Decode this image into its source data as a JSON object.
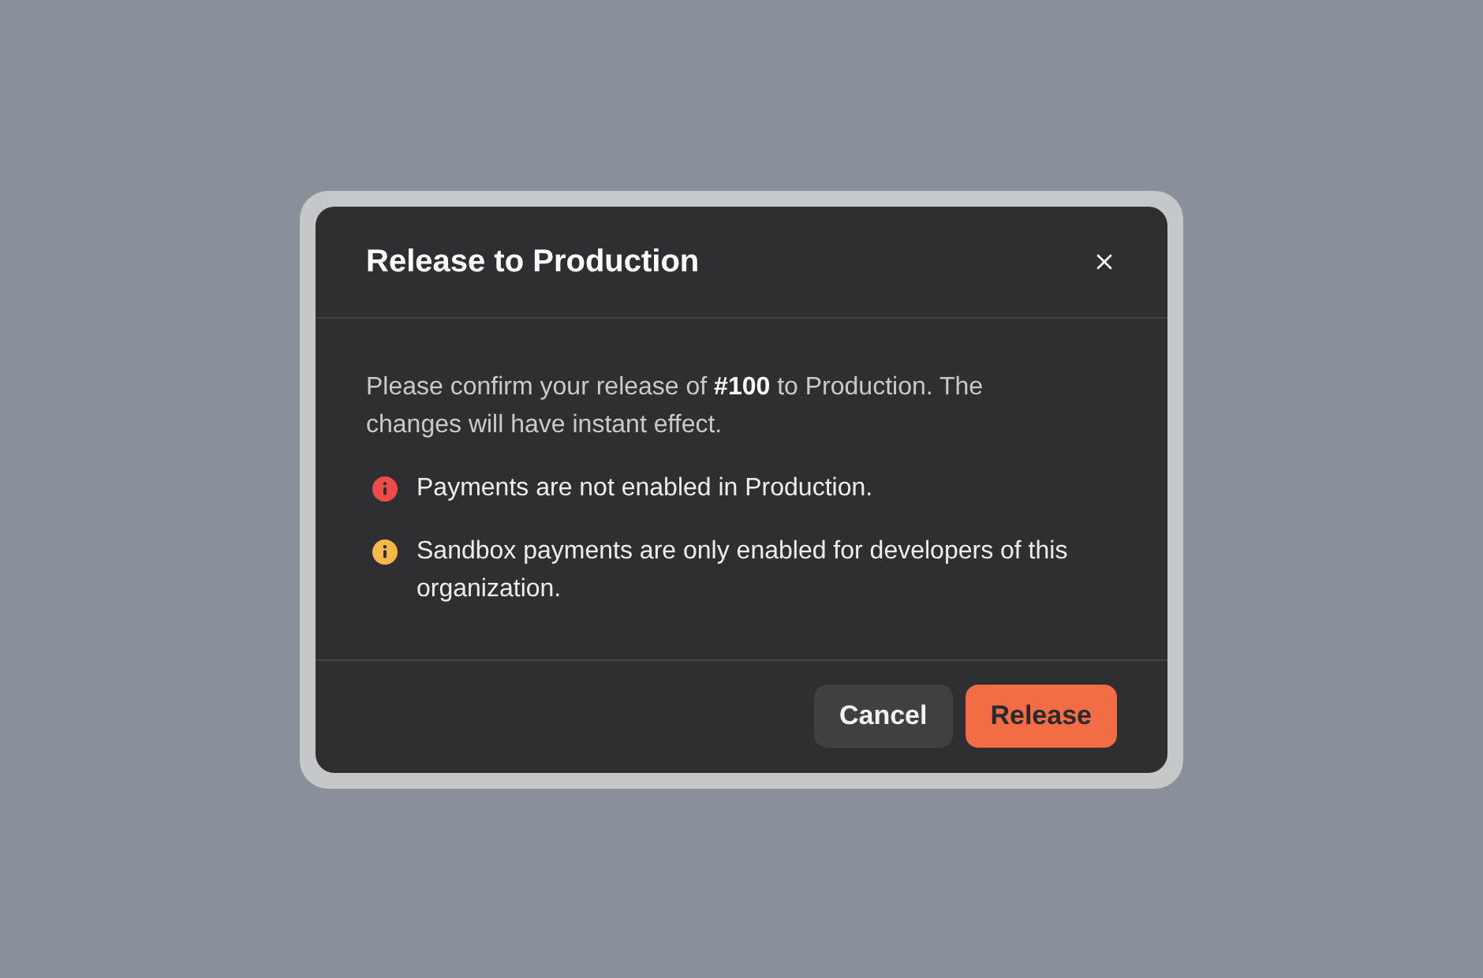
{
  "dialog": {
    "title": "Release to Production"
  },
  "message": "Please confirm your release of **#100** to Production. The changes will have instant effect.",
  "notices": [
    {
      "text": "Payments are not enabled in Production.",
      "color": "#f04b4b"
    },
    {
      "text": "Sandbox payments are only enabled for developers of this organization.",
      "color": "#f7b84b"
    }
  ],
  "buttons": [
    {
      "label": "Cancel",
      "kind": "secondary"
    },
    {
      "label": "Release",
      "kind": "primary"
    }
  ]
}
